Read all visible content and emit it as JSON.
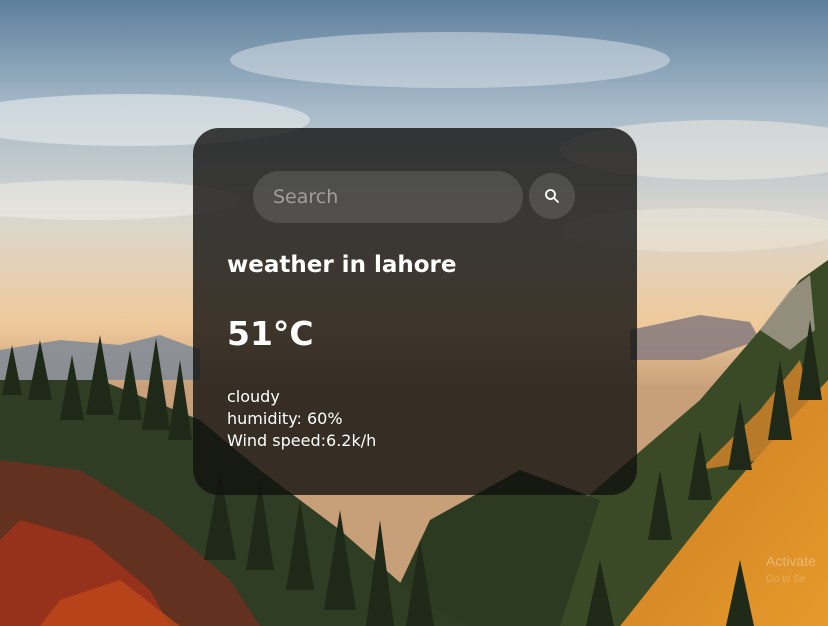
{
  "search": {
    "placeholder": "Search",
    "value": "",
    "button_icon": "search-icon"
  },
  "weather": {
    "title": "weather in lahore",
    "temperature": "51°C",
    "condition": "cloudy",
    "humidity": "humidity: 60%",
    "wind": "Wind speed:6.2k/h"
  },
  "watermark": {
    "title": "Activate",
    "subtitle": "Go to Se"
  },
  "colors": {
    "card_background": "#12100f",
    "text": "#ffffff"
  }
}
